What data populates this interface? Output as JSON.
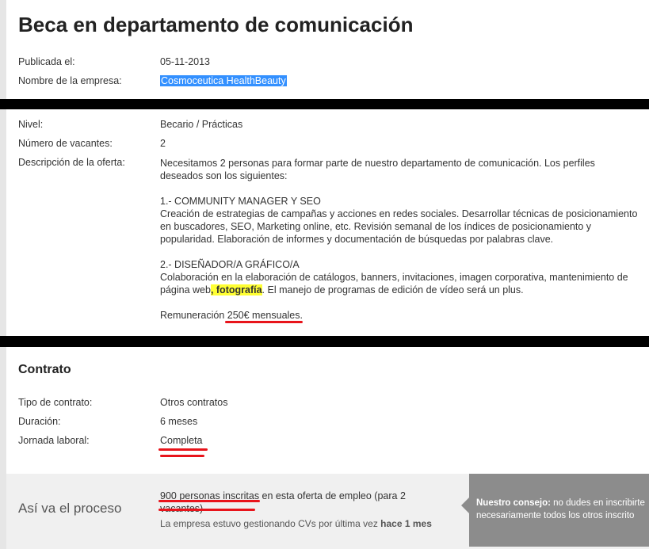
{
  "header": {
    "title": "Beca en departamento de comunicación"
  },
  "meta": {
    "published_label": "Publicada el:",
    "published_value": "05-11-2013",
    "company_label": "Nombre de la empresa:",
    "company_value": "Cosmoceutica HealthBeauty"
  },
  "offer": {
    "level_label": "Nivel:",
    "level_value": "Becario / Prácticas",
    "vacancies_label": "Número de vacantes:",
    "vacancies_value": "2",
    "description_label": "Descripción de la oferta:",
    "intro": "Necesitamos 2 personas para formar parte de nuestro departamento de comunicación. Los perfiles deseados son los siguientes:",
    "role1_title": "1.- COMMUNITY MANAGER Y SEO",
    "role1_text": "Creación de estrategias de campañas y acciones en redes sociales. Desarrollar técnicas de posicionamiento en buscadores, SEO, Marketing online, etc. Revisión semanal de los índices de posicionamiento y popularidad. Elaboración de informes y documentación de búsquedas por palabras clave.",
    "role2_title": "2.- DISEÑADOR/A GRÁFICO/A",
    "role2_text_a": "Colaboración en la elaboración de catálogos, banners, invitaciones, imagen corporativa, mantenimiento de página web",
    "role2_highlight": ", fotografía",
    "role2_text_b": ". El manejo de programas de edición de vídeo será un plus.",
    "salary_prefix": "Remuneración ",
    "salary_value": "250€ mensuales",
    "salary_suffix": "."
  },
  "contract": {
    "title": "Contrato",
    "type_label": "Tipo de contrato:",
    "type_value": "Otros contratos",
    "duration_label": "Duración:",
    "duration_value": "6 meses",
    "schedule_label": "Jornada laboral:",
    "schedule_value": "Completa"
  },
  "process": {
    "title": "Así va el proceso",
    "registered": "900 personas inscritas",
    "registered_rest": " en esta oferta de empleo (para 2 vacantes)",
    "last_activity_prefix": "La empresa estuvo gestionando CVs por última vez ",
    "last_activity_value": "hace 1 mes"
  },
  "tip": {
    "label": "Nuestro consejo:",
    "line1": " no dudes en inscribirte",
    "line2": "necesariamente todos los otros inscrito"
  },
  "colors": {
    "selection": "#3390ff",
    "highlight": "#ffff33",
    "annotation": "#e8141b",
    "tip_background": "#8c8c8c"
  }
}
